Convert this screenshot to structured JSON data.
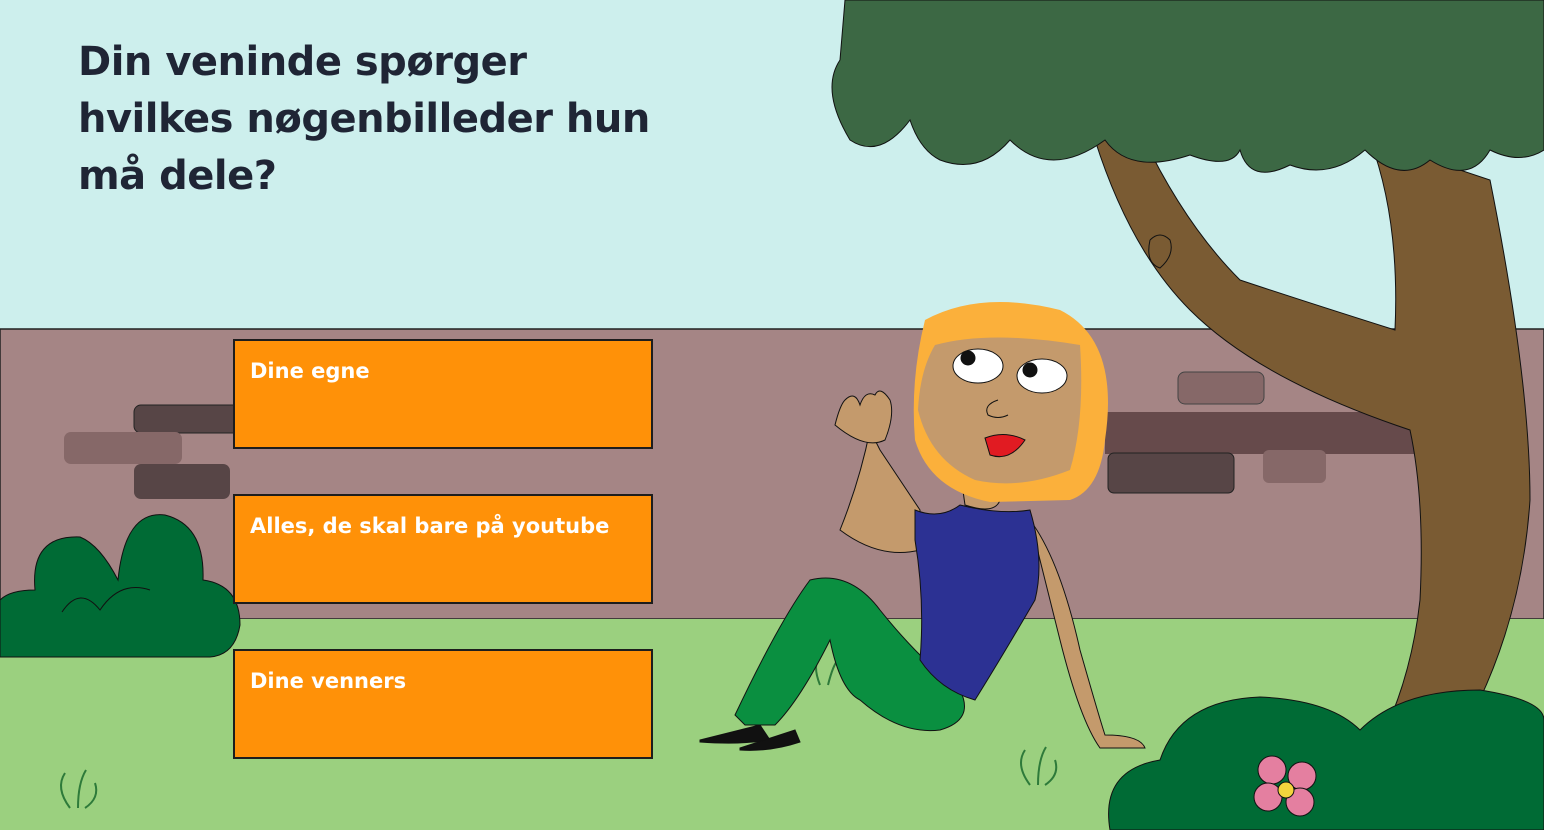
{
  "question": "Din veninde spørger hvilkes nøgenbilleder hun må dele?",
  "answers": [
    {
      "label": "Dine egne"
    },
    {
      "label": "Alles, de skal bare på youtube"
    },
    {
      "label": "Dine venners"
    }
  ],
  "colors": {
    "sky": "#cdefed",
    "wall": "#a58585",
    "grass": "#9bd07f",
    "answer_bg": "#ff9108",
    "title_text": "#1f2535"
  }
}
